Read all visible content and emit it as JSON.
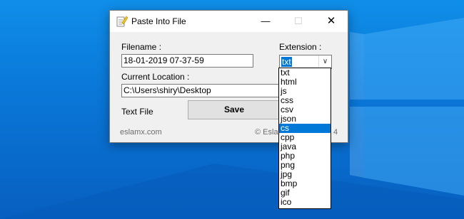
{
  "window": {
    "title": "Paste Into File",
    "minimize_glyph": "—",
    "maximize_glyph": "☐",
    "close_glyph": "✕",
    "app_icon": "notepad-paste-icon"
  },
  "form": {
    "filename_label": "Filename :",
    "filename_value": "18-01-2019 07-37-59",
    "extension_label": "Extension :",
    "extension_value": "txt",
    "location_label": "Current Location :",
    "location_value": "C:\\Users\\shiry\\Desktop",
    "filetype_text": "Text File",
    "save_label": "Save"
  },
  "footer": {
    "left": "eslamx.com",
    "right_prefix": "© Esla",
    "right_suffix": "4"
  },
  "extension_dropdown": {
    "selected": "cs",
    "options": [
      "txt",
      "html",
      "js",
      "css",
      "csv",
      "json",
      "cs",
      "cpp",
      "java",
      "php",
      "png",
      "jpg",
      "bmp",
      "gif",
      "ico"
    ]
  }
}
